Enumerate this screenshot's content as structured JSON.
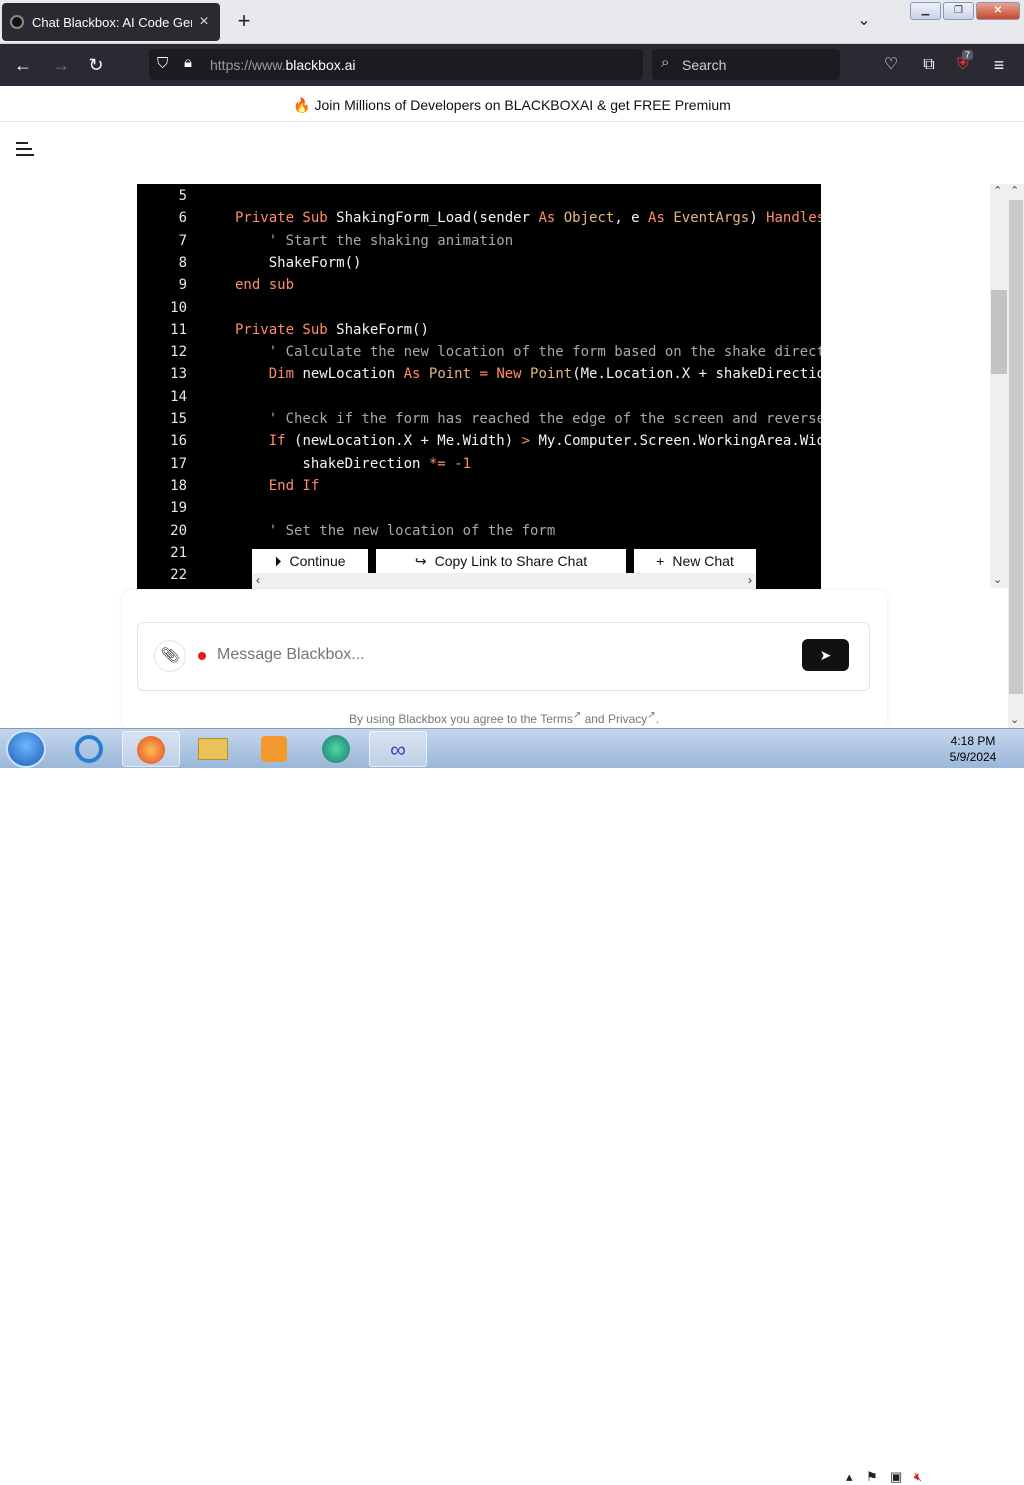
{
  "browser": {
    "tab_title": "Chat Blackbox: AI Code Genera",
    "url_dim": "https://www.",
    "url_main": "blackbox.ai",
    "search_placeholder": "Search",
    "extension_badge": "7"
  },
  "banner": {
    "text": "🔥 Join Millions of Developers on BLACKBOXAI & get FREE Premium"
  },
  "code": {
    "lines": [
      {
        "n": "5",
        "segs": []
      },
      {
        "n": "6",
        "segs": [
          [
            "kw",
            "Private Sub "
          ],
          [
            "",
            "ShakingForm_Load(sender "
          ],
          [
            "kw",
            "As "
          ],
          [
            "ty",
            "Object"
          ],
          [
            "",
            ", e "
          ],
          [
            "kw",
            "As "
          ],
          [
            "ty",
            "EventArgs"
          ],
          [
            "",
            ") "
          ],
          [
            "kw",
            "Handles MyBase.Load"
          ]
        ]
      },
      {
        "n": "7",
        "segs": [
          [
            "cm",
            "    ' Start the shaking animation"
          ]
        ]
      },
      {
        "n": "8",
        "segs": [
          [
            "",
            "    ShakeForm()"
          ]
        ]
      },
      {
        "n": "9",
        "segs": [
          [
            "kw",
            "end sub"
          ]
        ]
      },
      {
        "n": "10",
        "segs": []
      },
      {
        "n": "11",
        "segs": [
          [
            "kw",
            "Private Sub "
          ],
          [
            "",
            "ShakeForm()"
          ]
        ]
      },
      {
        "n": "12",
        "segs": [
          [
            "cm",
            "    ' Calculate the new location of the form based on the shake direction"
          ]
        ]
      },
      {
        "n": "13",
        "segs": [
          [
            "kw",
            "    Dim "
          ],
          [
            "",
            "newLocation "
          ],
          [
            "kw",
            "As "
          ],
          [
            "ty",
            "Point "
          ],
          [
            "kw",
            "= New "
          ],
          [
            "ty",
            "Point"
          ],
          [
            "",
            "(Me.Location.X + shakeDirection"
          ]
        ]
      },
      {
        "n": "14",
        "segs": []
      },
      {
        "n": "15",
        "segs": [
          [
            "cm",
            "    ' Check if the form has reached the edge of the screen and reverse"
          ]
        ]
      },
      {
        "n": "16",
        "segs": [
          [
            "kw",
            "    If "
          ],
          [
            "",
            "(newLocation.X + Me.Width) "
          ],
          [
            "kw",
            "> "
          ],
          [
            "",
            "My.Computer.Screen.WorkingArea.Width"
          ]
        ]
      },
      {
        "n": "17",
        "segs": [
          [
            "",
            "        shakeDirection "
          ],
          [
            "kw",
            "*= -1"
          ]
        ]
      },
      {
        "n": "18",
        "segs": [
          [
            "kw",
            "    End If"
          ]
        ]
      },
      {
        "n": "19",
        "segs": []
      },
      {
        "n": "20",
        "segs": [
          [
            "cm",
            "    ' Set the new location of the form"
          ]
        ]
      },
      {
        "n": "21",
        "segs": []
      },
      {
        "n": "22",
        "segs": []
      }
    ]
  },
  "actions": {
    "continue": "Continue",
    "copy_link": "Copy Link to Share Chat",
    "new_chat": "New Chat"
  },
  "composer": {
    "placeholder": "Message Blackbox...",
    "terms_prefix": "By using Blackbox you agree to the ",
    "terms_link": "Terms",
    "terms_and": " and ",
    "privacy_link": "Privacy"
  },
  "taskbar": {
    "time": "4:18 PM",
    "date": "5/9/2024"
  }
}
